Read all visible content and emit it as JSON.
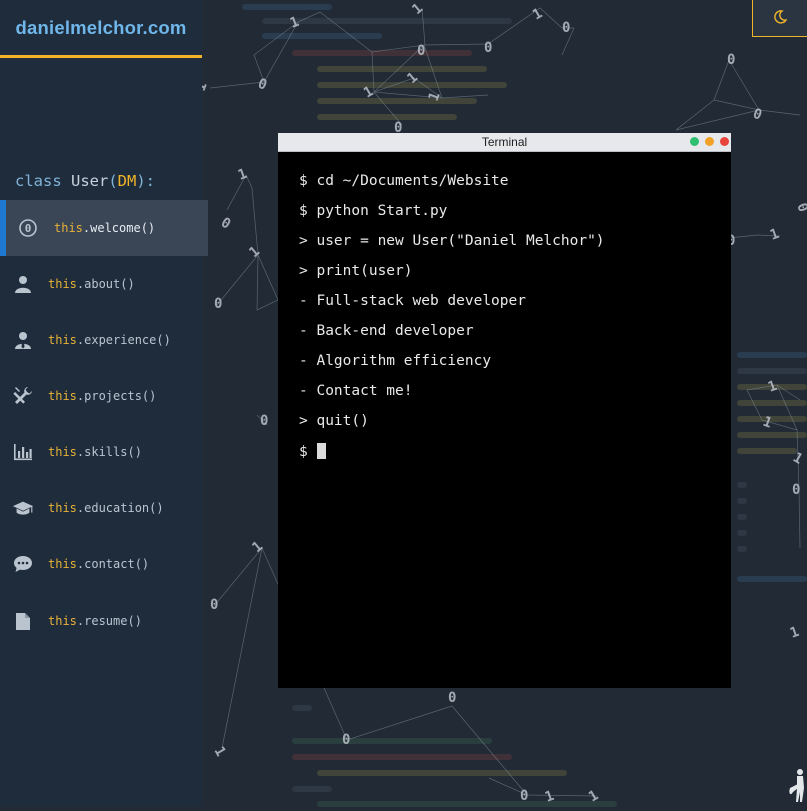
{
  "brand": {
    "title": "danielmelchor.com"
  },
  "sidebar": {
    "class_line": {
      "keyword": "class ",
      "name": "User",
      "open": "(",
      "dm": "DM",
      "close": "):"
    },
    "items": [
      {
        "this": "this",
        "method": ".welcome()",
        "icon": "welcome-icon",
        "active": true
      },
      {
        "this": "this",
        "method": ".about()",
        "icon": "user-icon"
      },
      {
        "this": "this",
        "method": ".experience()",
        "icon": "user-tie-icon"
      },
      {
        "this": "this",
        "method": ".projects()",
        "icon": "tools-icon"
      },
      {
        "this": "this",
        "method": ".skills()",
        "icon": "bar-chart-icon"
      },
      {
        "this": "this",
        "method": ".education()",
        "icon": "graduation-cap-icon"
      },
      {
        "this": "this",
        "method": ".contact()",
        "icon": "chat-icon"
      },
      {
        "this": "this",
        "method": ".resume()",
        "icon": "document-icon"
      }
    ]
  },
  "theme_toggle": {
    "icon": "moon-icon"
  },
  "terminal": {
    "title": "Terminal",
    "lines": [
      "$ cd ~/Documents/Website",
      "$ python Start.py",
      "> user = new User(\"Daniel Melchor\")",
      "> print(user)",
      "- Full-stack web developer",
      "- Back-end developer",
      "- Algorithm efficiency",
      "- Contact me!",
      "> quit()"
    ],
    "prompt": "$ "
  },
  "colors": {
    "accent": "#f0b429",
    "brand": "#6fb6ea",
    "active_border": "#1f78d1",
    "sidebar_bg": "#1f2c3b",
    "page_bg": "#212a35"
  }
}
